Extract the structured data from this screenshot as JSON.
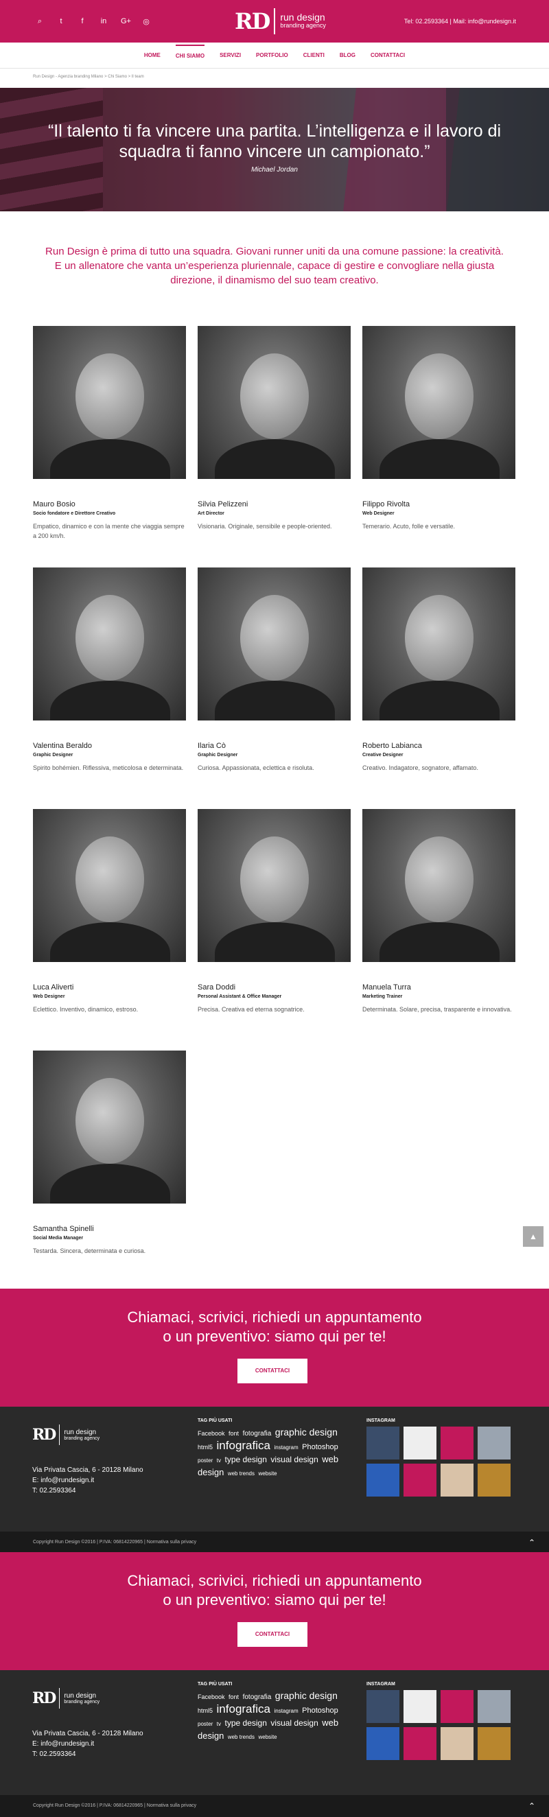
{
  "header": {
    "social_icons": [
      "search-icon",
      "twitter-icon",
      "facebook-icon",
      "linkedin-icon",
      "google-plus-icon",
      "instagram-icon"
    ],
    "social_glyphs": [
      "⌕",
      "t",
      "f",
      "in",
      "G+",
      "◎"
    ],
    "logo_mark": "RD",
    "logo_name": "run design",
    "logo_tagline": "branding agency",
    "contact": "Tel: 02.2593364 | Mail: info@rundesign.it"
  },
  "nav": [
    "HOME",
    "CHI SIAMO",
    "SERVIZI",
    "PORTFOLIO",
    "CLIENTI",
    "BLOG",
    "CONTATTACI"
  ],
  "breadcrumb": "Run Design - Agenzia branding Milano > Chi Siamo > Il team",
  "hero": {
    "quote": "“Il talento ti fa vincere una partita. L’intelligenza e il lavoro di squadra ti fanno vincere un campionato.”",
    "author": "Michael Jordan"
  },
  "intro": "Run Design è prima di tutto una squadra. Giovani runner uniti da una comune passione: la creatività. E un allenatore che vanta un’esperienza pluriennale, capace di gestire e convogliare nella giusta direzione, il dinamismo del suo team creativo.",
  "team": [
    {
      "name": "Mauro Bosio",
      "role": "Socio fondatore e Direttore Creativo",
      "desc": "Empatico, dinamico e con la mente che viaggia sempre a 200 km/h."
    },
    {
      "name": "Silvia Pelizzeni",
      "role": "Art Director",
      "desc": "Visionaria. Originale, sensibile e people-oriented."
    },
    {
      "name": "Filippo Rivolta",
      "role": "Web Designer",
      "desc": "Temerario. Acuto, folle e versatile."
    },
    {
      "name": "Valentina Beraldo",
      "role": "Graphic Designer",
      "desc": "Spirito bohémien. Riflessiva, meticolosa e determinata."
    },
    {
      "name": "Ilaria Cò",
      "role": "Graphic Designer",
      "desc": "Curiosa. Appassionata, eclettica e risoluta."
    },
    {
      "name": "Roberto Labianca",
      "role": "Creative Designer",
      "desc": "Creativo. Indagatore, sognatore, affamato."
    },
    {
      "name": "Luca Aliverti",
      "role": "Web Designer",
      "desc": "Eclettico. Inventivo, dinamico, estroso."
    },
    {
      "name": "Sara Doddi",
      "role": "Personal Assistant & Office Manager",
      "desc": "Precisa. Creativa ed eterna sognatrice."
    },
    {
      "name": "Manuela Turra",
      "role": "Marketing Trainer",
      "desc": "Determinata. Solare, precisa, trasparente e innovativa."
    },
    {
      "name": "Samantha Spinelli",
      "role": "Social Media Manager",
      "desc": "Testarda. Sincera, determinata e curiosa."
    }
  ],
  "cta": {
    "line1": "Chiamaci, scrivici, richiedi un appuntamento",
    "line2": "o un preventivo: siamo qui per te!",
    "button": "CONTATTACI"
  },
  "footer": {
    "logo_mark": "RD",
    "logo_name": "run design",
    "logo_tagline": "branding agency",
    "address": "Via Privata Cascia, 6 - 20128 Milano",
    "email": "E: info@rundesign.it",
    "phone": "T: 02.2593364",
    "tags_title": "TAG PIÙ USATI",
    "tags": [
      {
        "t": "Facebook",
        "s": 9
      },
      {
        "t": "font",
        "s": 9
      },
      {
        "t": "fotografia",
        "s": 10
      },
      {
        "t": "graphic design",
        "s": 14
      },
      {
        "t": "html5",
        "s": 9
      },
      {
        "t": "infografica",
        "s": 17
      },
      {
        "t": "instagram",
        "s": 8
      },
      {
        "t": "Photoshop",
        "s": 11
      },
      {
        "t": "poster",
        "s": 8
      },
      {
        "t": "tv",
        "s": 8
      },
      {
        "t": "type design",
        "s": 12
      },
      {
        "t": "visual design",
        "s": 12
      },
      {
        "t": "web design",
        "s": 13
      },
      {
        "t": "web trends",
        "s": 8
      },
      {
        "t": "website",
        "s": 8
      }
    ],
    "instagram_title": "INSTAGRAM",
    "instagram_colors": [
      "#3a4d6a",
      "#eeeeee",
      "#c2185b",
      "#9aa4b0",
      "#2b5fb8",
      "#c2185b",
      "#d9c2a8",
      "#b8862e"
    ],
    "copyright": "Copyright Run Design ©2016 | P.IVA: 06814220965 | Normativa sulla privacy"
  },
  "colors": {
    "brand": "#c2185b",
    "footer": "#2a2a2a"
  }
}
